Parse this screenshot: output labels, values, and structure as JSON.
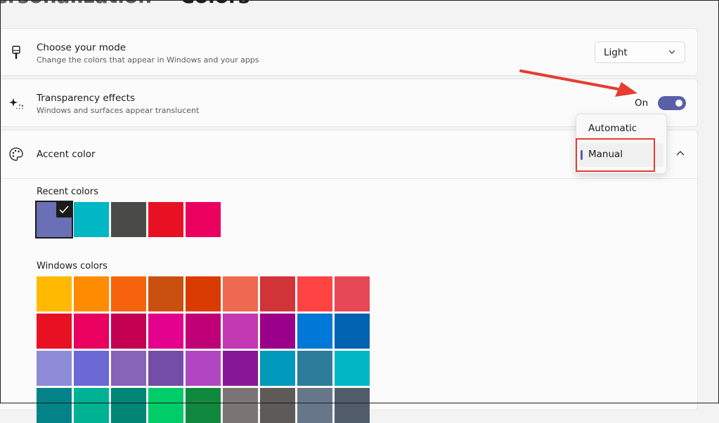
{
  "breadcrumb": {
    "parent": "ersonalization",
    "separator": "›",
    "current": "Colors"
  },
  "mode_row": {
    "icon": "brush-icon",
    "title": "Choose your mode",
    "subtitle": "Change the colors that appear in Windows and your apps",
    "select_value": "Light"
  },
  "transparency_row": {
    "icon": "sparkle-icon",
    "title": "Transparency effects",
    "subtitle": "Windows and surfaces appear translucent",
    "toggle_label": "On",
    "toggle_on": true
  },
  "accent_row": {
    "icon": "palette-icon",
    "title": "Accent color",
    "expanded": true
  },
  "accent_popup": {
    "options": [
      "Automatic",
      "Manual"
    ],
    "selected": "Manual"
  },
  "recent_colors": {
    "label": "Recent colors",
    "colors": [
      "#6b6fb6",
      "#00b7c3",
      "#4a4a48",
      "#e81123",
      "#ea005e"
    ],
    "selected_index": 0
  },
  "windows_colors": {
    "label": "Windows colors",
    "rows": [
      [
        "#ffb900",
        "#ff8c00",
        "#f7630c",
        "#ca5010",
        "#da3b01",
        "#ef6950",
        "#d13438",
        "#ff4343",
        "#e74856"
      ],
      [
        "#e81123",
        "#ea005e",
        "#c30052",
        "#e3008c",
        "#bf0077",
        "#c239b3",
        "#9a0089",
        "#0078d7",
        "#0063b1"
      ],
      [
        "#8e8cd8",
        "#6b69d6",
        "#8764b8",
        "#744da9",
        "#b146c2",
        "#881798",
        "#0099bc",
        "#2d7d9a",
        "#00b7c3"
      ],
      [
        "#038387",
        "#00b294",
        "#018574",
        "#00cc6a",
        "#10893e",
        "#7a7574",
        "#5d5a58",
        "#68768a",
        "#515c6b"
      ]
    ]
  }
}
